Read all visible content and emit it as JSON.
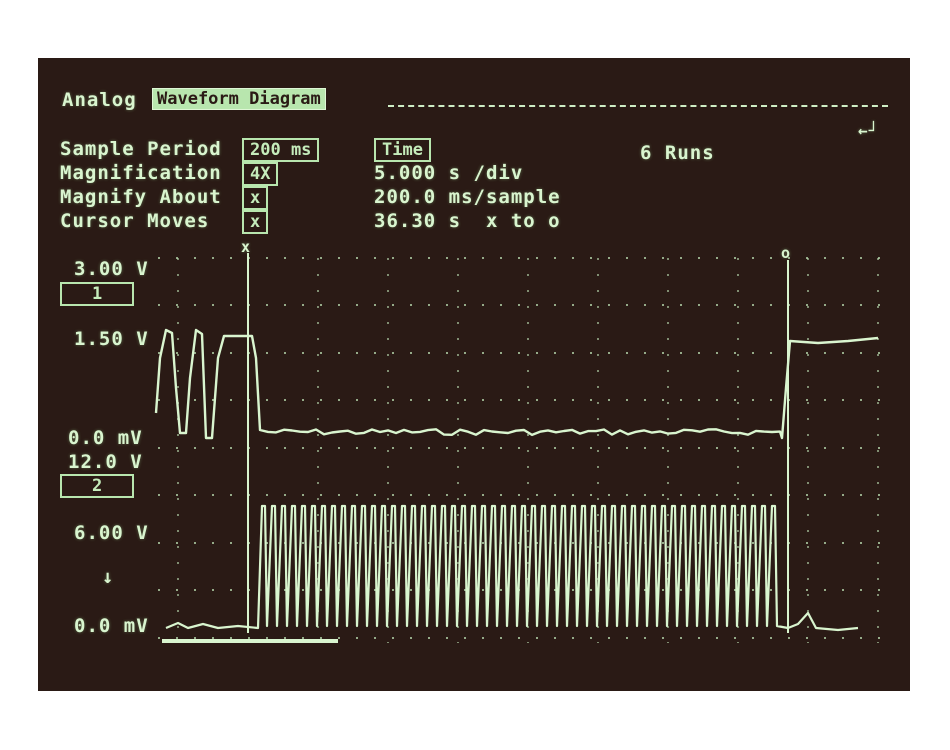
{
  "header": {
    "mode": "Analog",
    "menu_label": "Waveform Diagram",
    "corner_symbol": "←┘"
  },
  "settings": [
    {
      "label": "Sample Period",
      "field": "200 ms"
    },
    {
      "label": "Magnification",
      "field": "4X"
    },
    {
      "label": "Magnify About",
      "field": "x"
    },
    {
      "label": "Cursor Moves",
      "field": "x"
    }
  ],
  "time_field": "Time",
  "readouts": {
    "time_per_div": "5.000 s /div",
    "sample_rate": "200.0 ms/sample",
    "cursor_delta": "36.30 s  x to o",
    "runs": "6 Runs"
  },
  "cursors": {
    "x_marker": "x",
    "o_marker": "o"
  },
  "channels": [
    {
      "id": "1",
      "top_label": "3.00 V",
      "mid_label": "1.50 V",
      "bottom_label": "0.0 mV"
    },
    {
      "id": "2",
      "top_label": "12.0 V",
      "mid_label": "6.00 V",
      "extra_label": "↓",
      "bottom_label": "0.0 mV"
    }
  ],
  "colors": {
    "screen_bg": "#2a1a15",
    "trace": "#d9f5cf",
    "field_bg": "#b8e6ae"
  }
}
